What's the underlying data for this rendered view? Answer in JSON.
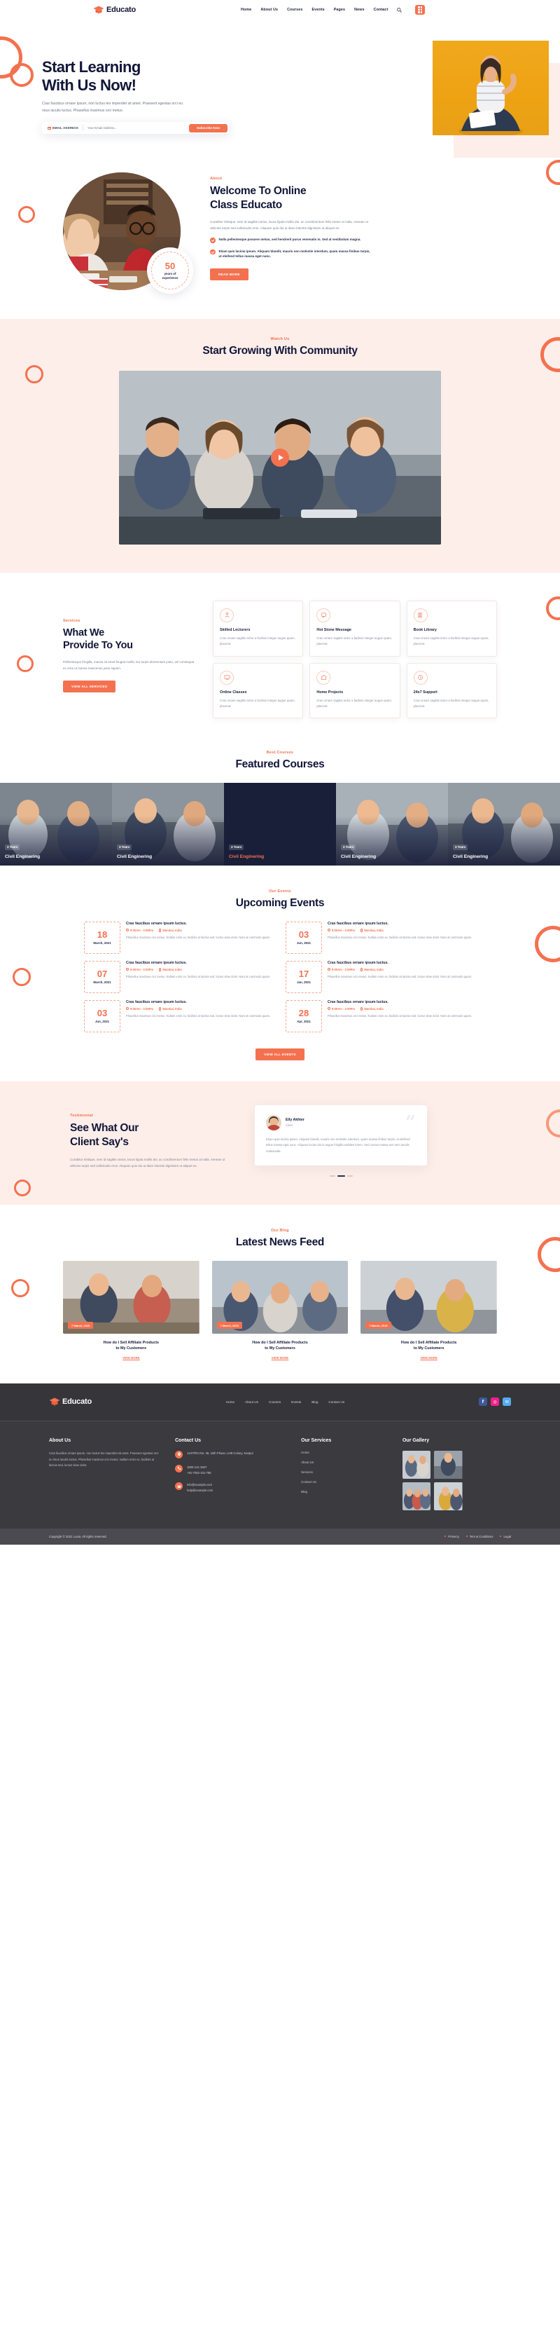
{
  "brand": {
    "name": "Educato",
    "icon": "graduation-cap-icon"
  },
  "nav": {
    "items": [
      "Home",
      "About Us",
      "Courses",
      "Events",
      "Pages",
      "News",
      "Contact"
    ],
    "search_icon": "search-icon",
    "menu_icon": "grid-menu-icon"
  },
  "hero": {
    "title_line1": "Start Learning",
    "title_line2": "With Us Now!",
    "paragraph": "Cras faucibus ornare ipsum, non luctus leo imperdiet sit amet. Praesent egestas orci eu risus iaculis luctus. Phasellus maximus orci metus.",
    "form": {
      "label": "EMAIL ADDRESS",
      "placeholder": "Your Email Address...",
      "value": "",
      "button": "Subscribe Now",
      "mail_icon": "mail-icon"
    }
  },
  "about": {
    "eyebrow": "About",
    "title_line1": "Welcome To Online",
    "title_line2": "Class Educato",
    "paragraph": "Curabitur tristique, sem id sagittis varius, lacus ligula mollis dui, ac condimentum felis metus ut nulla. Aenean ut ultricies turpis sed sollicitudin eros. Aliquam quis dui ut diam lobortis dignissim ut aliquet ex.",
    "bullets": [
      "Nulla pellentesque posuere metus, sed hendrerit purus venenatis in. Sed at vestibulum magna.",
      "Etiam quis lacinia ipsum. Aliquam blandit, mauris non molestie interdum, quam massa finibus turpis, ut eleifend tellus massa eget nunc."
    ],
    "button": "READ MORE",
    "badge": {
      "number": "50",
      "caption_line1": "years of",
      "caption_line2": "experience"
    }
  },
  "community": {
    "eyebrow": "Watch Us",
    "title": "Start Growing With Community",
    "play_icon": "play-icon"
  },
  "services": {
    "eyebrow": "Services",
    "title_line1": "What We",
    "title_line2": "Provide To You",
    "paragraph": "Pellentesque fringilla, massa sit amet feugiat mollis, leo turpis elementum justo, vel consequat ex urna ut massa maecenas justo sapien.",
    "button": "VIEW ALL SERVICES",
    "cards": [
      {
        "icon": "lecturer-icon",
        "title": "Skilled Lecturers",
        "text": "Cras ornare sagittis tortor a facilisis integer augue quam, placerat."
      },
      {
        "icon": "message-icon",
        "title": "Hot Stone Message",
        "text": "Cras ornare sagittis tortor a facilisis integer augue quam, placerat."
      },
      {
        "icon": "library-icon",
        "title": "Book Library",
        "text": "Cras ornare sagittis tortor a facilisis integer augue quam, placerat."
      },
      {
        "icon": "online-class-icon",
        "title": "Online Classes",
        "text": "Cras ornare sagittis tortor a facilisis integer augue quam, placerat."
      },
      {
        "icon": "home-project-icon",
        "title": "Home Projects",
        "text": "Cras ornare sagittis tortor a facilisis integer augue quam, placerat."
      },
      {
        "icon": "support-icon",
        "title": "24x7 Support",
        "text": "Cras ornare sagittis tortor a facilisis integer augue quam, placerat."
      }
    ]
  },
  "featured": {
    "eyebrow": "Best Courses",
    "title": "Featured Courses",
    "courses": [
      {
        "years": "3 Years",
        "name": "Civil Enginering",
        "highlight": false
      },
      {
        "years": "3 Years",
        "name": "Civil Enginering",
        "highlight": false
      },
      {
        "years": "3 Years",
        "name": "Civil Enginering",
        "highlight": true
      },
      {
        "years": "3 Years",
        "name": "Civil Enginering",
        "highlight": false
      },
      {
        "years": "3 Years",
        "name": "Civil Enginering",
        "highlight": false
      }
    ]
  },
  "events": {
    "eyebrow": "Our Events",
    "title": "Upcoming Events",
    "button": "VIEW ALL EVENTS",
    "items": [
      {
        "day": "18",
        "month": "March, 2021",
        "title": "Cras faucibus ornare ipsum luctus.",
        "time": "9:00Am - 3:00Pm",
        "place": "Mumbai, India",
        "text": "Phasellus maximus orci metus. Nullam enim ex, facilisis at lacinia sed, luctus vitae dolor. Nam at commodo quam."
      },
      {
        "day": "03",
        "month": "Jun, 2021",
        "title": "Cras faucibus ornare ipsum luctus.",
        "time": "9:00Am - 3:00Pm",
        "place": "Mumbai, India",
        "text": "Phasellus maximus orci metus. Nullam enim ex, facilisis at lacinia sed, luctus vitae dolor. Nam at commodo quam."
      },
      {
        "day": "07",
        "month": "March, 2021",
        "title": "Cras faucibus ornare ipsum luctus.",
        "time": "9:00Am - 3:00Pm",
        "place": "Mumbai, India",
        "text": "Phasellus maximus orci metus. Nullam enim ex, facilisis at lacinia sed, luctus vitae dolor. Nam at commodo quam."
      },
      {
        "day": "17",
        "month": "Jan, 2021",
        "title": "Cras faucibus ornare ipsum luctus.",
        "time": "9:00Am - 3:00Pm",
        "place": "Mumbai, India",
        "text": "Phasellus maximus orci metus. Nullam enim ex, facilisis at lacinia sed, luctus vitae dolor. Nam at commodo quam."
      },
      {
        "day": "03",
        "month": "Jun, 2021",
        "title": "Cras faucibus ornare ipsum luctus.",
        "time": "9:00Am - 3:00Pm",
        "place": "Mumbai, India",
        "text": "Phasellus maximus orci metus. Nullam enim ex, facilisis at lacinia sed, luctus vitae dolor. Nam at commodo quam."
      },
      {
        "day": "28",
        "month": "Apr, 2021",
        "title": "Cras faucibus ornare ipsum luctus.",
        "time": "9:00Am - 3:00Pm",
        "place": "Mumbai, India",
        "text": "Phasellus maximus orci metus. Nullam enim ex, facilisis at lacinia sed, luctus vitae dolor. Nam at commodo quam."
      }
    ]
  },
  "testimonial": {
    "eyebrow": "Testimonial",
    "title_line1": "See What Our",
    "title_line2": "Client Say's",
    "paragraph": "Curabitur tristique, sem id sagittis varius, lacus ligula mollis dui, ac condimentum felis metus ut nulla. Aenean ut ultricies turpis sed sollicitudin eros. Aliquam quis dui ut diam lobortis dignissim ut aliquet ex.",
    "quote": {
      "name": "Eily Akhter",
      "role": "Client",
      "text": "Etiam quis lacinia ipsum. Aliquam blandit, mauris non molestie interdum, quam massa finibus turpis, ut eleifend tellus massa eget nunc. Aliquam luctus dui in augue fringilla sodales lorem. Sed cursus massa non sem iaculis malesuada.",
      "quote_mark": "”"
    }
  },
  "blog": {
    "eyebrow": "Our Blog",
    "title": "Latest News Feed",
    "posts": [
      {
        "tag": "7 March, 2019",
        "title_line1": "How do I Sell Affiliate Products",
        "title_line2": "to My Customers",
        "link": "VIEW MORE"
      },
      {
        "tag": "7 March, 2019",
        "title_line1": "How do I Sell Affiliate Products",
        "title_line2": "to My Customers",
        "link": "VIEW MORE"
      },
      {
        "tag": "7 March, 2019",
        "title_line1": "How do I Sell Affiliate Products",
        "title_line2": "to My Customers",
        "link": "VIEW MORE"
      }
    ]
  },
  "footer": {
    "nav": [
      "Home",
      "About Us",
      "Courses",
      "Events",
      "Blog",
      "Contact Us"
    ],
    "socials": [
      {
        "name": "facebook-icon",
        "glyph": "f",
        "color": "#3b5998"
      },
      {
        "name": "instagram-icon",
        "glyph": "◎",
        "color": "#f0208a"
      },
      {
        "name": "twitter-icon",
        "glyph": "✉",
        "color": "#55acee"
      }
    ],
    "about": {
      "heading": "About Us",
      "text": "Cras faucibus ornare ipsum, non luctus leo imperdiet sit amet. Praesent egestas orci eu risus iaculis luctus. Phasellus maximus orci metus. Nullam enim ex, facilisis at lacinia sed, luctus vitae dolor."
    },
    "contact": {
      "heading": "Contact Us",
      "address": "1247/Plot No. 39, 15th Phase, LHB Colony, Kanpur",
      "phone1": "1800-121-3637",
      "phone2": "+91-7052-101-786",
      "email1": "info@example.com",
      "email2": "help@example.com",
      "address_icon": "location-pin-icon",
      "phone_icon": "phone-icon",
      "mail_icon": "mail-icon"
    },
    "services": {
      "heading": "Our Services",
      "items": [
        "Home",
        "About Us",
        "Services",
        "Contact Us",
        "Blog"
      ]
    },
    "gallery": {
      "heading": "Our Gallery"
    },
    "copyright": "Copyright © 2021 Luxia. All rights reserved.",
    "legal_links": [
      "Privercy",
      "Tem & Conditions",
      "Legal"
    ]
  },
  "colors": {
    "accent": "#f4714f",
    "dark": "#121739",
    "soft_pink": "#fdeeea"
  }
}
